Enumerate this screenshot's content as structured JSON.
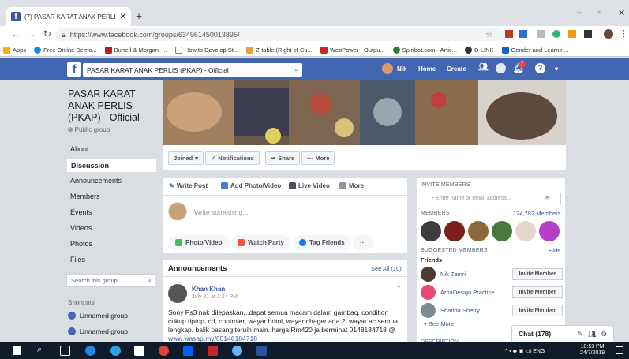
{
  "browser": {
    "tab_title": "(7) PASAR KARAT ANAK PERLIS (P",
    "url": "https://www.facebook.com/groups/634961450013895/",
    "bookmarks": [
      "Apps",
      "Free Online Demo...",
      "Burrell & Morgan -...",
      "How to Develop St...",
      "Z-table (Right of Cu...",
      "WebPower - Outpu...",
      "Spinbot.com - Artic...",
      "D-LINK",
      "Gender and Learnin..."
    ]
  },
  "header": {
    "search_value": "PASAR KARAT ANAK PERLIS (PKAP) - Official",
    "user": "Nik",
    "home": "Home",
    "create": "Create",
    "notif_count": "7"
  },
  "group": {
    "name": "PASAR KARAT ANAK PERLIS (PKAP) - Official",
    "type": "Public group"
  },
  "left_nav": [
    "About",
    "Discussion",
    "Announcements",
    "Members",
    "Events",
    "Videos",
    "Photos",
    "Files"
  ],
  "search_group_placeholder": "Search this group",
  "shortcuts": {
    "title": "Shortcuts",
    "items": [
      "Unnamed group",
      "Unnamed group"
    ]
  },
  "actions": {
    "joined": "Joined",
    "notifications": "Notifications",
    "share": "Share",
    "more": "More"
  },
  "composer": {
    "tabs": [
      "Write Post",
      "Add Photo/Video",
      "Live Video",
      "More"
    ],
    "placeholder": "Write something...",
    "pills": [
      "Photo/Video",
      "Watch Party",
      "Tag Friends"
    ]
  },
  "announcements": {
    "title": "Announcements",
    "see_all": "See All (10)",
    "post": {
      "author": "Khan Khan",
      "date": "July 21 at 1:24 PM",
      "text": "Sony Ps3 nak dilepaskan...dapat semua macam dalam gambaq..condition cukup tiptop, cd, controler, wayar hdmi, wayar chager ada 2, wayar ac semua lengkap, balik pasang teruih main..harga Rm420 ja berminat 0148184718 @ ",
      "link": "www.wasap.my/60148184718"
    }
  },
  "right": {
    "invite_title": "INVITE MEMBERS",
    "invite_placeholder": "+ Enter name or email address...",
    "members_title": "MEMBERS",
    "members_count": "124,782 Members",
    "suggested_title": "SUGGESTED MEMBERS",
    "hide": "Hide",
    "friends_label": "Friends",
    "suggested": [
      {
        "name": "Nik Zamri",
        "button": "Invite Member"
      },
      {
        "name": "ArnaDesign Practice",
        "button": "Invite Member"
      },
      {
        "name": "Sharida Sherry",
        "button": "Invite Member"
      }
    ],
    "see_more": "See More",
    "description_title": "DESCRIPTION"
  },
  "chat": {
    "label": "Chat (178)"
  },
  "taskbar": {
    "time": "10:53 PM",
    "date": "24/7/2019",
    "lang": "ENG"
  }
}
